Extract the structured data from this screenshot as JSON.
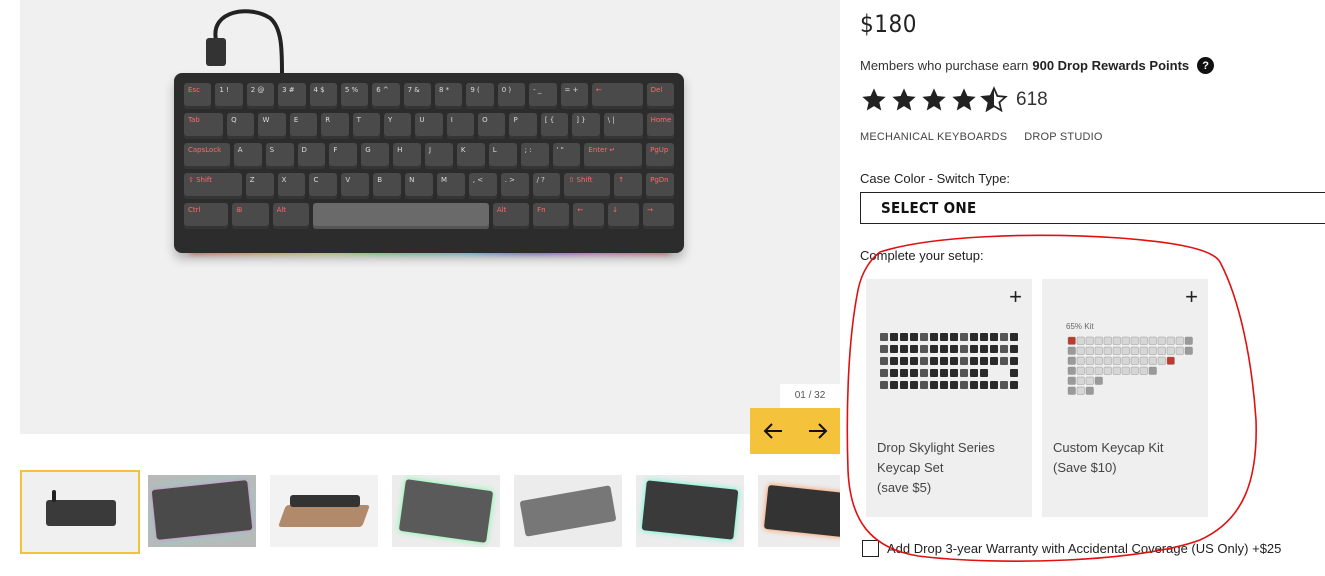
{
  "gallery": {
    "counter": "01 / 32",
    "prev_icon": "arrow-left-icon",
    "next_icon": "arrow-right-icon",
    "accent_color": "#f5c33b"
  },
  "keyboard": {
    "rows": [
      [
        "Esc",
        "1 !",
        "2 @",
        "3 #",
        "4 $",
        "5 %",
        "6 ^",
        "7 &",
        "8 *",
        "9 (",
        "0 )",
        "- _",
        "= +",
        "←",
        "Del"
      ],
      [
        "Tab",
        "Q",
        "W",
        "E",
        "R",
        "T",
        "Y",
        "U",
        "I",
        "O",
        "P",
        "[ {",
        "] }",
        "\\ |",
        "Home"
      ],
      [
        "CapsLock",
        "A",
        "S",
        "D",
        "F",
        "G",
        "H",
        "J",
        "K",
        "L",
        "; :",
        "' \"",
        "Enter ↵",
        "PgUp"
      ],
      [
        "⇧ Shift",
        "Z",
        "X",
        "C",
        "V",
        "B",
        "N",
        "M",
        ", <",
        ". >",
        "/ ?",
        "⇧ Shift",
        "↑",
        "PgDn"
      ],
      [
        "Ctrl",
        "⊞",
        "Alt",
        "",
        "Alt",
        "Fn",
        "←",
        "↓",
        "→"
      ]
    ]
  },
  "product": {
    "price": "$180",
    "rewards_prefix": "Members who purchase earn",
    "rewards_bold": "900 Drop Rewards Points",
    "rating_value": 4.5,
    "rating_count": "618",
    "tags": [
      "MECHANICAL KEYBOARDS",
      "DROP STUDIO"
    ],
    "case_label": "Case Color - Switch Type:",
    "select_value": "SELECT ONE",
    "setup_label": "Complete your setup:",
    "addons": [
      {
        "lines": [
          "Drop Skylight Series",
          "Keycap Set",
          "(save $5)"
        ]
      },
      {
        "lines": [
          "Custom Keycap Kit",
          "(Save $10)"
        ],
        "kit_label": "65% Kit"
      }
    ],
    "warranty_text": "Add Drop 3-year Warranty with Accidental Coverage (US Only) +$25"
  },
  "annotation_color": "#e01010"
}
